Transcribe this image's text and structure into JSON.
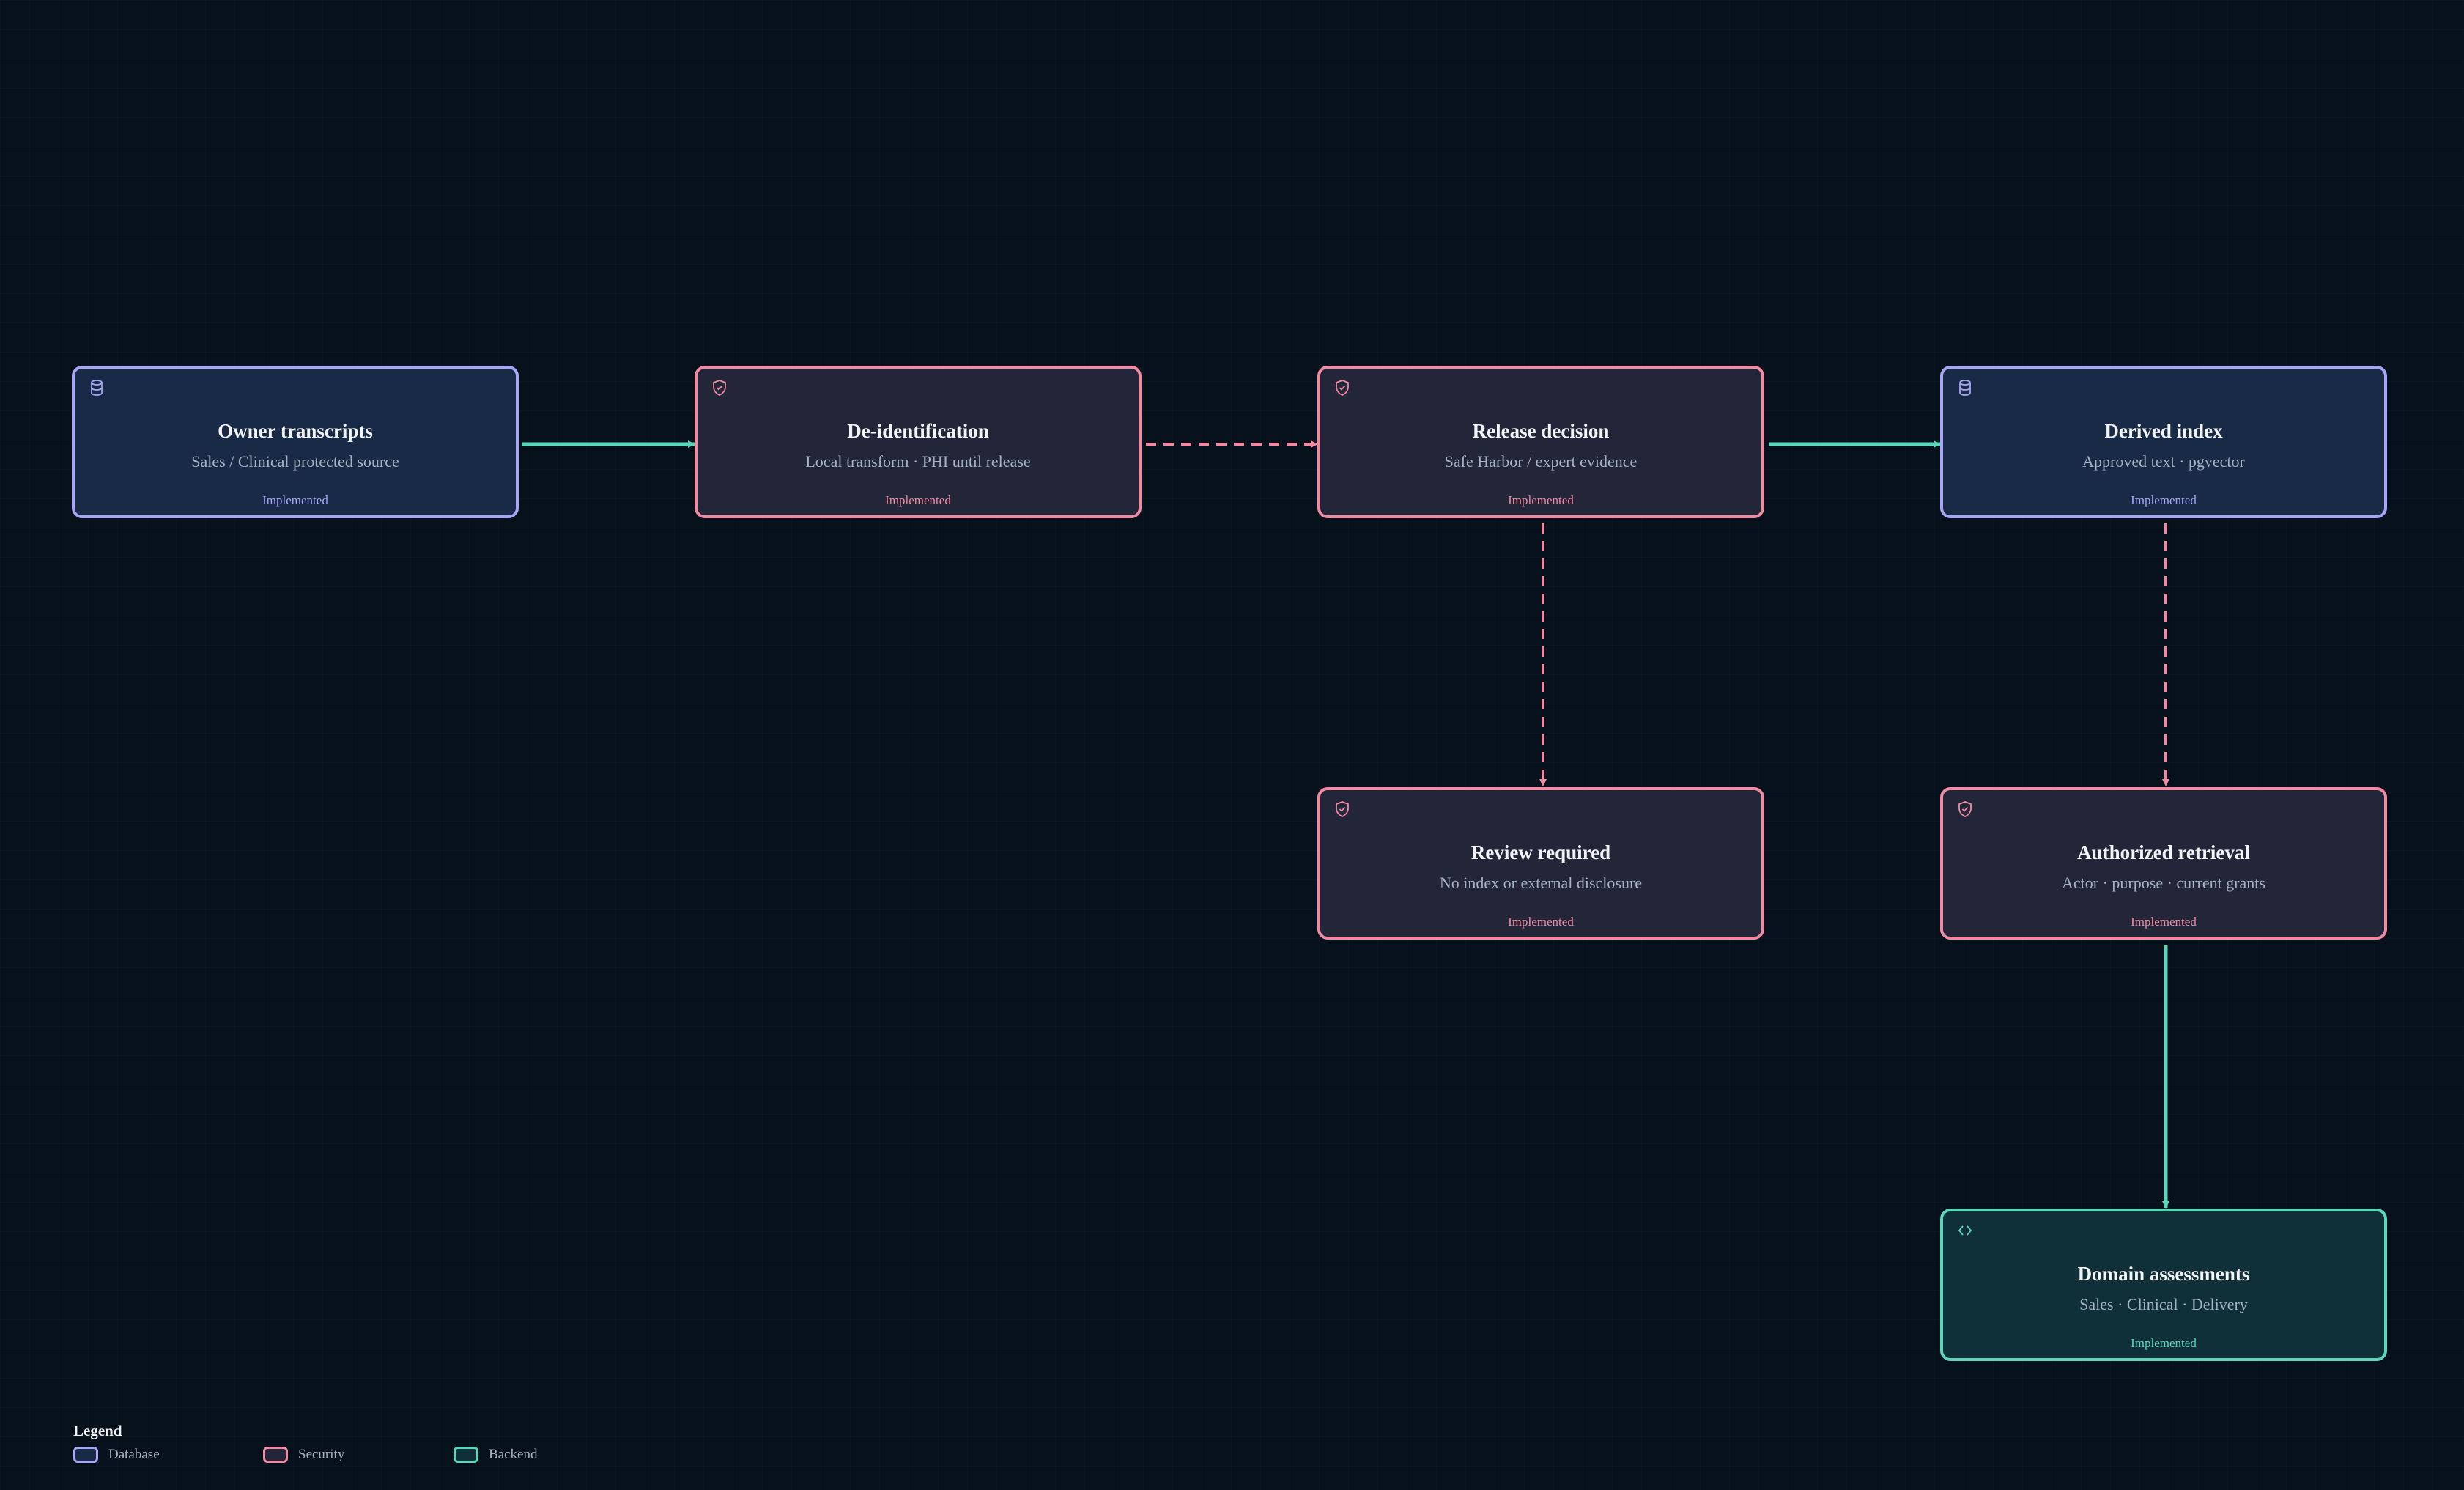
{
  "colors": {
    "background": "#07111b",
    "database": "#a8a5f7",
    "security": "#f08aa2",
    "backend": "#5ad7bb"
  },
  "nodes": [
    {
      "id": "owner-transcripts",
      "kind": "database",
      "icon": "database-icon",
      "title": "Owner transcripts",
      "subtitle": "Sales / Clinical protected source",
      "status": "Implemented"
    },
    {
      "id": "de-identification",
      "kind": "security",
      "icon": "shield-check-icon",
      "title": "De-identification",
      "subtitle": "Local transform · PHI until release",
      "status": "Implemented"
    },
    {
      "id": "release-decision",
      "kind": "security",
      "icon": "shield-check-icon",
      "title": "Release decision",
      "subtitle": "Safe Harbor / expert evidence",
      "status": "Implemented"
    },
    {
      "id": "derived-index",
      "kind": "database",
      "icon": "database-icon",
      "title": "Derived index",
      "subtitle": "Approved text · pgvector",
      "status": "Implemented"
    },
    {
      "id": "review-required",
      "kind": "security",
      "icon": "shield-check-icon",
      "title": "Review required",
      "subtitle": "No index or external disclosure",
      "status": "Implemented"
    },
    {
      "id": "authorized-retrieval",
      "kind": "security",
      "icon": "shield-check-icon",
      "title": "Authorized retrieval",
      "subtitle": "Actor · purpose · current grants",
      "status": "Implemented"
    },
    {
      "id": "domain-assessments",
      "kind": "backend",
      "icon": "code-icon",
      "title": "Domain assessments",
      "subtitle": "Sales · Clinical · Delivery",
      "status": "Implemented"
    }
  ],
  "edges": [
    {
      "from": "owner-transcripts",
      "to": "de-identification",
      "style": "solid",
      "color": "#5ad7bb"
    },
    {
      "from": "de-identification",
      "to": "release-decision",
      "style": "dashed",
      "color": "#f08aa2"
    },
    {
      "from": "release-decision",
      "to": "derived-index",
      "style": "solid",
      "color": "#5ad7bb"
    },
    {
      "from": "release-decision",
      "to": "review-required",
      "style": "dashed",
      "color": "#f08aa2"
    },
    {
      "from": "derived-index",
      "to": "authorized-retrieval",
      "style": "dashed",
      "color": "#f08aa2"
    },
    {
      "from": "authorized-retrieval",
      "to": "domain-assessments",
      "style": "solid",
      "color": "#5ad7bb"
    }
  ],
  "legend": {
    "title": "Legend",
    "items": [
      {
        "kind": "database",
        "label": "Database"
      },
      {
        "kind": "security",
        "label": "Security"
      },
      {
        "kind": "backend",
        "label": "Backend"
      }
    ]
  }
}
